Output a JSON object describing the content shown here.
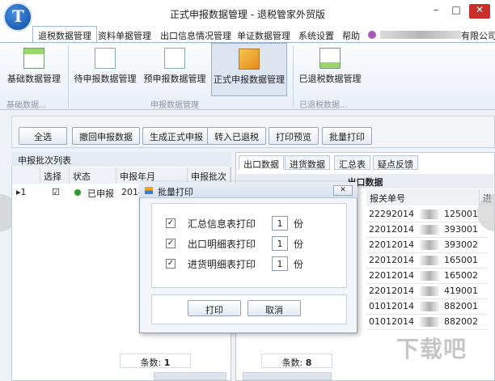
{
  "window": {
    "title": "正式申报数据管理 - 退税管家外贸版",
    "logo_letter": "T",
    "min": "–",
    "max": "□",
    "close": "✕"
  },
  "menu": {
    "items": [
      "退税数据管理",
      "资料单据管理",
      "出口信息情况管理",
      "单证数据管理",
      "系统设置",
      "帮助"
    ],
    "company_suffix": "有限公司"
  },
  "ribbon": {
    "buttons": [
      "基础数据管理",
      "待申报数据管理",
      "预申报数据管理",
      "正式申报数据管理",
      "已退税数据管理"
    ],
    "groups": [
      "基础数据...",
      "申报数据管理",
      "已退税数据..."
    ]
  },
  "toolbar": {
    "buttons": [
      "全选",
      "撤回申报数据",
      "生成正式申报",
      "转入已退税",
      "打印预览",
      "批量打印"
    ]
  },
  "left_panel": {
    "title": "申报批次列表",
    "columns": [
      "选择",
      "状态",
      "申报年月",
      "申报批次"
    ],
    "row": {
      "index": "1",
      "checked": "☑",
      "status": "已申报",
      "year_month": "2014"
    },
    "count_label": "条数:",
    "count": "1"
  },
  "right_panel": {
    "tabs": [
      "出口数据",
      "进货数据",
      "汇总表",
      "疑点反馈"
    ],
    "table_title": "出口数据",
    "columns": [
      "报关单号",
      "进"
    ],
    "rows": [
      {
        "prefix": "22292014",
        "suffix": "125001"
      },
      {
        "prefix": "22012014",
        "suffix": "393001"
      },
      {
        "prefix": "22012014",
        "suffix": "393002"
      },
      {
        "prefix": "22012014",
        "suffix": "165001"
      },
      {
        "prefix": "22012014",
        "suffix": "165002"
      },
      {
        "prefix": "22012014",
        "suffix": "419001"
      },
      {
        "prefix": "01012014",
        "suffix": "882001"
      },
      {
        "prefix": "01012014",
        "suffix": "882002"
      }
    ],
    "count_label": "条数:",
    "count": "8"
  },
  "dialog": {
    "title": "批量打印",
    "options": [
      {
        "label": "汇总信息表打印",
        "copies": "1",
        "unit": "份",
        "checked": "✓"
      },
      {
        "label": "出口明细表打印",
        "copies": "1",
        "unit": "份",
        "checked": "✓"
      },
      {
        "label": "进货明细表打印",
        "copies": "1",
        "unit": "份",
        "checked": "✓"
      }
    ],
    "print_label": "打印",
    "cancel_label": "取消",
    "close_glyph": "✕"
  },
  "watermark": "下载吧",
  "colors": {
    "status_dot": "#2e9b2e",
    "close_button": "#c9302c",
    "accent": "#9cb8d8"
  }
}
